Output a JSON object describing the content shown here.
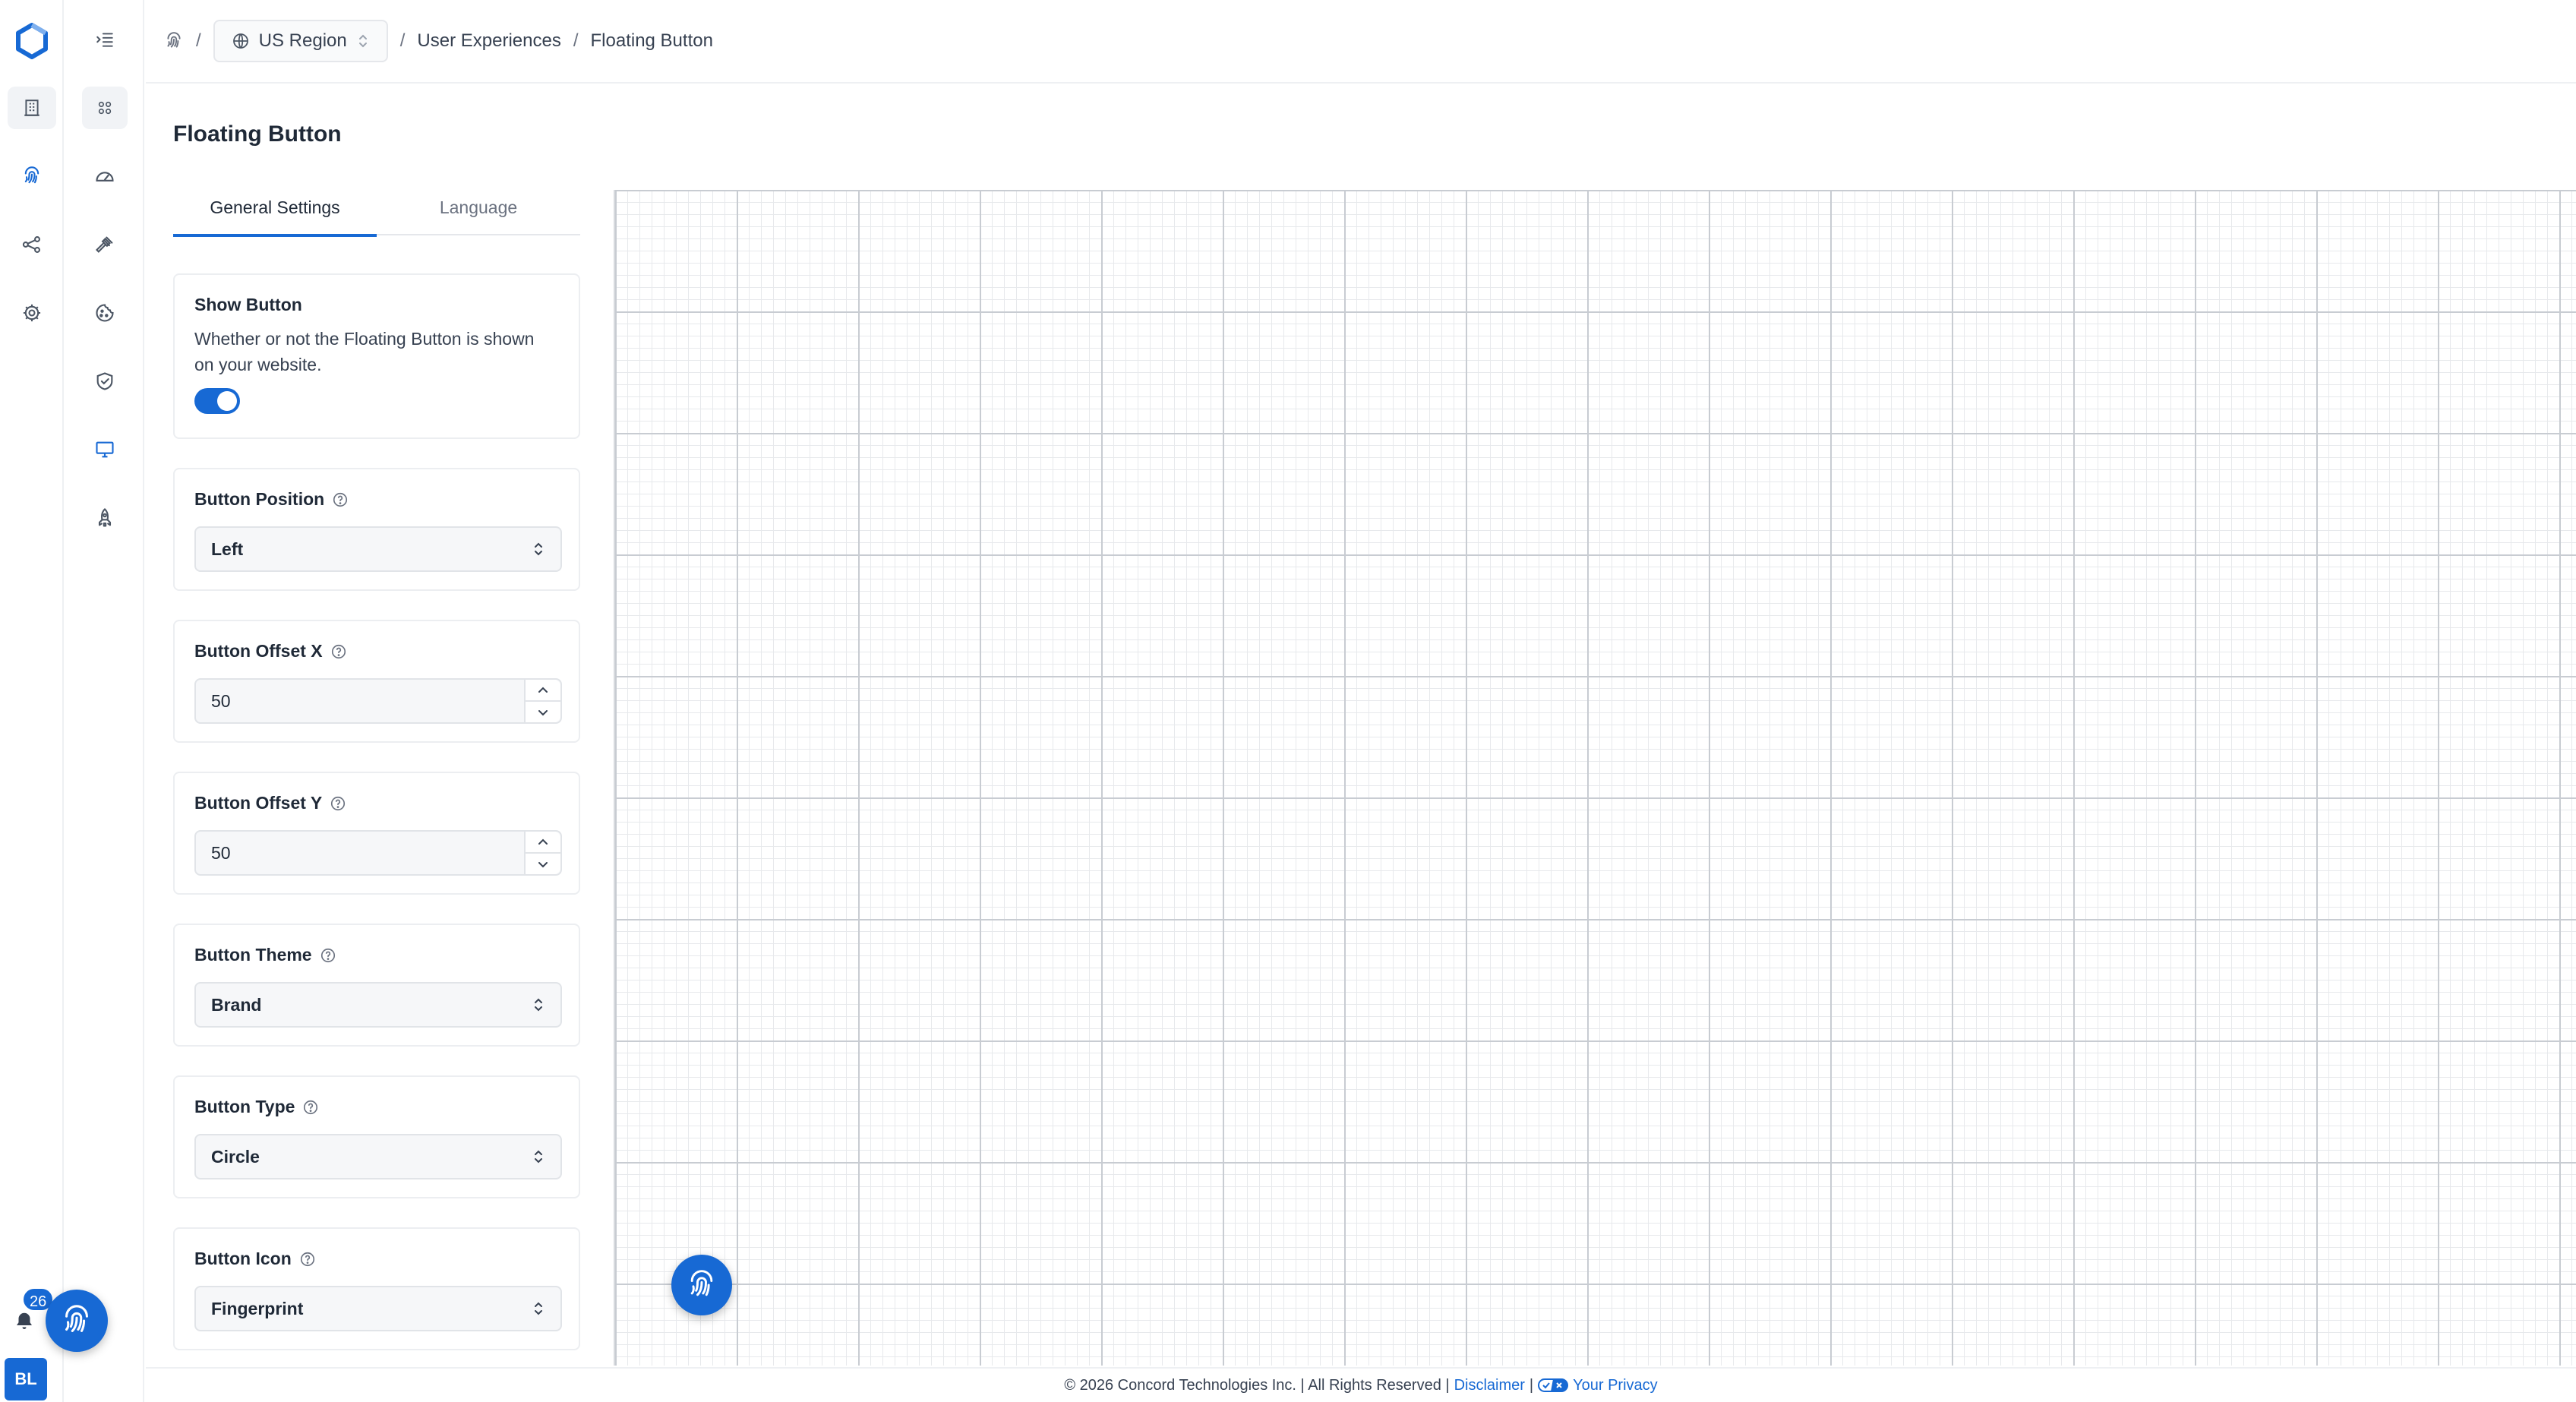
{
  "app": {
    "brand_color": "#1769d4"
  },
  "rail": {
    "items": [
      {
        "icon": "building-icon"
      },
      {
        "icon": "fingerprint-icon"
      },
      {
        "icon": "share-nodes-icon"
      },
      {
        "icon": "gear-icon"
      }
    ],
    "notification_count": "26",
    "avatar_initials": "BL"
  },
  "subnav": {
    "items": [
      {
        "icon": "collapse-menu-icon"
      },
      {
        "icon": "grid-icon"
      },
      {
        "icon": "gauge-icon"
      },
      {
        "icon": "gavel-icon"
      },
      {
        "icon": "cookie-icon"
      },
      {
        "icon": "shield-check-icon"
      },
      {
        "icon": "monitor-icon"
      },
      {
        "icon": "rocket-icon"
      }
    ]
  },
  "breadcrumb": {
    "separator": "/",
    "region": "US Region",
    "section": "User Experiences",
    "current": "Floating Button"
  },
  "page": {
    "title": "Floating Button"
  },
  "tabs": [
    {
      "label": "General Settings",
      "active": true
    },
    {
      "label": "Language",
      "active": false
    }
  ],
  "settings": {
    "show_button": {
      "label": "Show Button",
      "description": "Whether or not the Floating Button is shown on your website.",
      "enabled": true
    },
    "position": {
      "label": "Button Position",
      "value": "Left"
    },
    "offset_x": {
      "label": "Button Offset X",
      "value": "50"
    },
    "offset_y": {
      "label": "Button Offset Y",
      "value": "50"
    },
    "theme": {
      "label": "Button Theme",
      "value": "Brand"
    },
    "type": {
      "label": "Button Type",
      "value": "Circle"
    },
    "icon": {
      "label": "Button Icon",
      "value": "Fingerprint"
    }
  },
  "footer": {
    "copyright": "© 2026 Concord Technologies Inc. | All Rights Reserved |",
    "disclaimer": "Disclaimer",
    "pipe": "|",
    "privacy": "Your Privacy"
  }
}
